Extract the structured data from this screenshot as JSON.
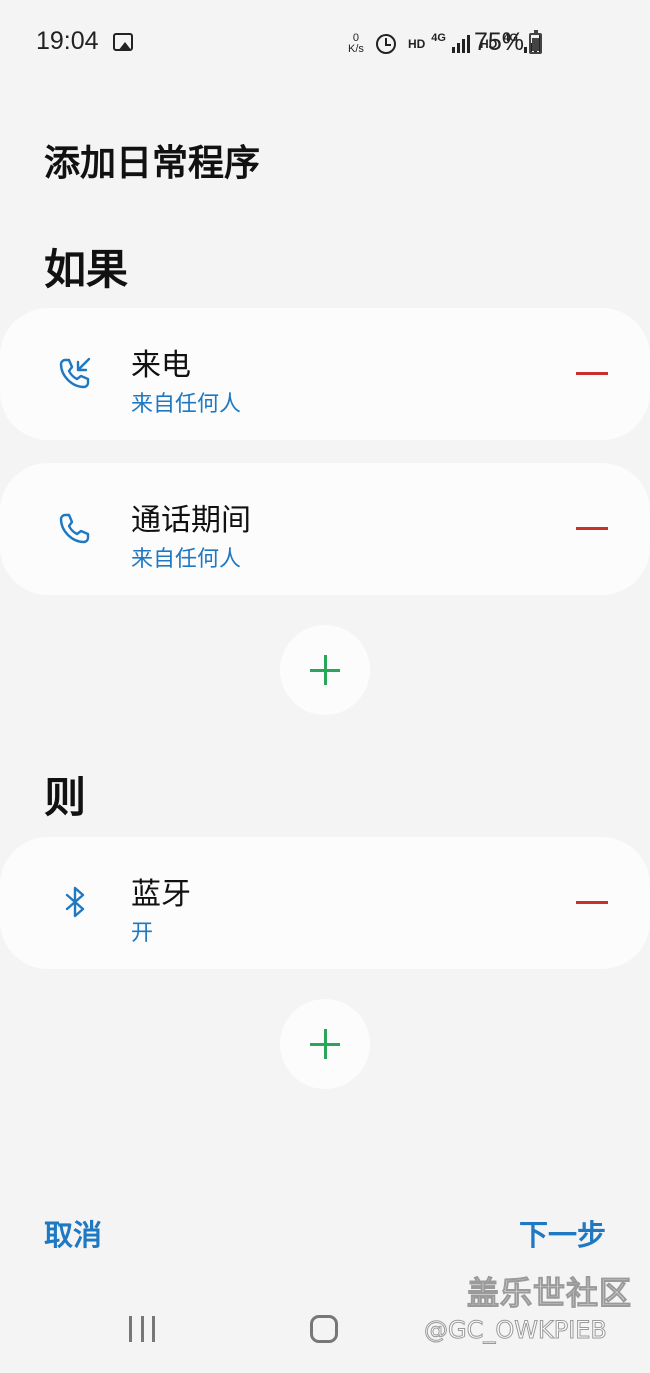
{
  "status_bar": {
    "time": "19:04",
    "netspeed_value": "0",
    "netspeed_unit": "K/s",
    "hd1": "HD",
    "net1": "4G",
    "hd2": "HD",
    "net2": "4G",
    "battery": "75%",
    "battery_level": 0.75
  },
  "page": {
    "title": "添加日常程序"
  },
  "if_section": {
    "title": "如果",
    "conditions": [
      {
        "icon": "incoming-call-icon",
        "title": "来电",
        "subtitle": "来自任何人"
      },
      {
        "icon": "phone-icon",
        "title": "通话期间",
        "subtitle": "来自任何人"
      }
    ]
  },
  "then_section": {
    "title": "则",
    "actions": [
      {
        "icon": "bluetooth-icon",
        "title": "蓝牙",
        "subtitle": "开"
      }
    ]
  },
  "footer": {
    "cancel": "取消",
    "next": "下一步"
  },
  "watermark": {
    "line1": "盖乐世社区",
    "line2": "@GC_OWKPIEB"
  },
  "colors": {
    "accent_blue": "#1f79c2",
    "remove_red": "#c9312c",
    "add_green": "#2ba55b",
    "background": "#f4f4f4",
    "card": "#fcfcfc"
  }
}
